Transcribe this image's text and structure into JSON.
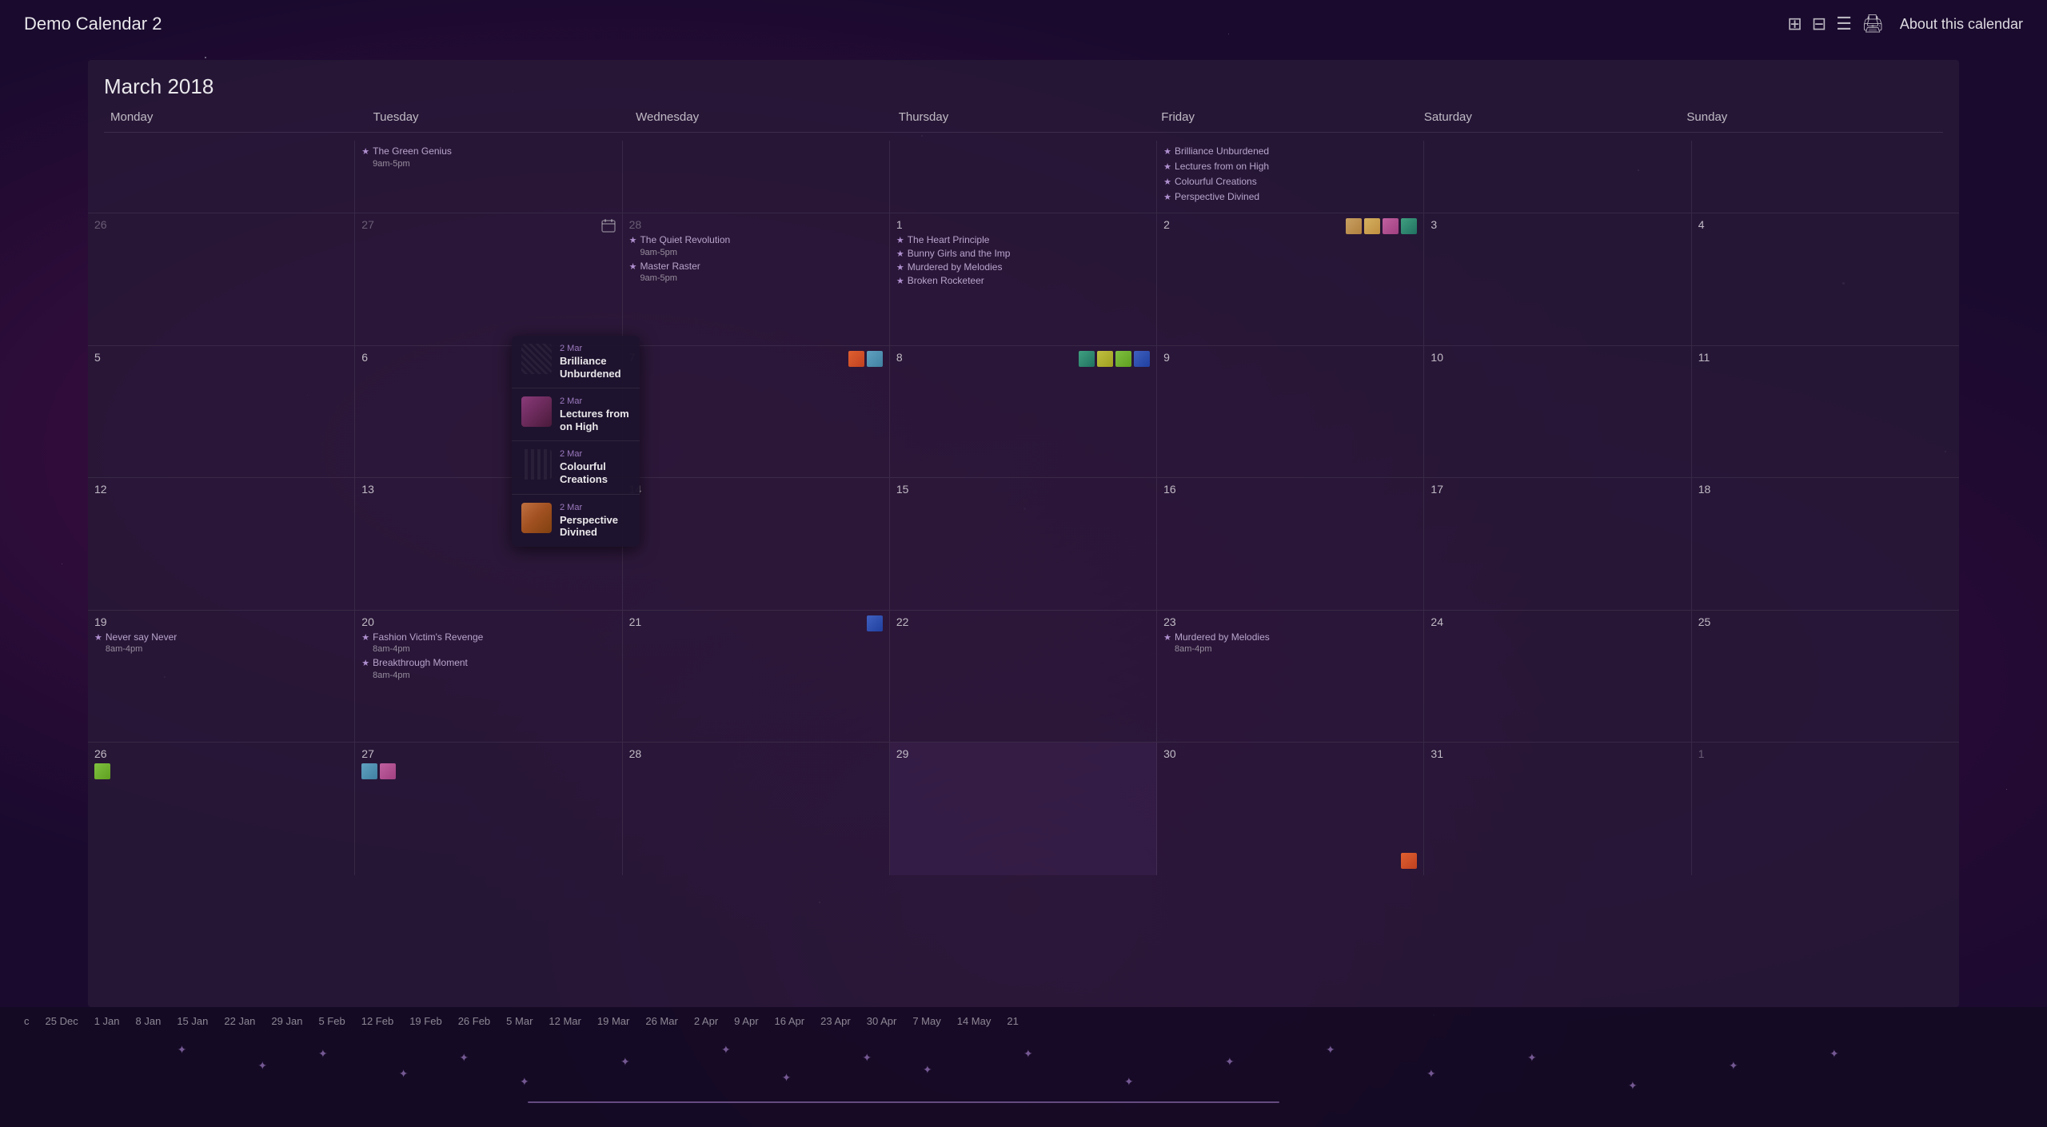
{
  "app": {
    "title": "Demo Calendar 2",
    "about_link": "About this calendar"
  },
  "calendar": {
    "month_title": "March 2018",
    "day_headers": [
      "Monday",
      "Tuesday",
      "Wednesday",
      "Thursday",
      "Friday",
      "Saturday",
      "Sunday"
    ],
    "prev_month_events": [
      {
        "date": "",
        "day_label": "Tuesday",
        "events": [
          {
            "name": "The Green Genius",
            "time": "9am-5pm"
          }
        ]
      },
      {
        "date": "",
        "day_label": "Friday",
        "events": [
          {
            "name": "Brilliance Unburdened"
          },
          {
            "name": "Lectures from on High"
          },
          {
            "name": "Colourful Creations"
          },
          {
            "name": "Perspective Divined"
          }
        ]
      }
    ],
    "weeks": [
      {
        "cells": [
          {
            "date": "26",
            "faded": true,
            "events": []
          },
          {
            "date": "27",
            "faded": true,
            "events": []
          },
          {
            "date": "28",
            "faded": true,
            "events": [
              {
                "name": "The Quiet Revolution",
                "time": "9am-5pm"
              },
              {
                "name": "Master Raster",
                "time": "9am-5pm"
              }
            ]
          },
          {
            "date": "1",
            "events": [
              {
                "name": "The Heart Principle"
              },
              {
                "name": "Bunny Girls and the Imp"
              },
              {
                "name": "Murdered by Melodies"
              },
              {
                "name": "Broken Rocketeer"
              }
            ]
          },
          {
            "date": "2",
            "events": [],
            "thumbs": [
              "tc1",
              "tc2",
              "tc3",
              "tc4"
            ]
          },
          {
            "date": "3",
            "events": []
          },
          {
            "date": "4",
            "events": []
          }
        ]
      },
      {
        "cells": [
          {
            "date": "5",
            "events": []
          },
          {
            "date": "6",
            "events": []
          },
          {
            "date": "7",
            "events": [],
            "thumbs": [
              "tc5",
              "tc6"
            ]
          },
          {
            "date": "8",
            "events": [],
            "thumbs": [
              "tc4",
              "tc9",
              "tc7",
              "tc8"
            ]
          },
          {
            "date": "9",
            "events": []
          },
          {
            "date": "10",
            "events": []
          },
          {
            "date": "11",
            "events": []
          }
        ]
      },
      {
        "cells": [
          {
            "date": "12",
            "events": []
          },
          {
            "date": "13",
            "events": []
          },
          {
            "date": "14",
            "events": []
          },
          {
            "date": "15",
            "events": []
          },
          {
            "date": "16",
            "events": []
          },
          {
            "date": "17",
            "events": []
          },
          {
            "date": "18",
            "events": []
          }
        ]
      },
      {
        "cells": [
          {
            "date": "19",
            "events": [
              {
                "name": "Never say Never",
                "time": "8am-4pm"
              }
            ]
          },
          {
            "date": "20",
            "events": [
              {
                "name": "Fashion Victim's Revenge",
                "time": "8am-4pm"
              },
              {
                "name": "Breakthrough Moment",
                "time": "8am-4pm"
              }
            ]
          },
          {
            "date": "21",
            "events": [],
            "thumbs_tr": [
              "tc8"
            ]
          },
          {
            "date": "22",
            "events": []
          },
          {
            "date": "23",
            "events": [
              {
                "name": "Murdered by Melodies",
                "time": "8am-4pm"
              }
            ]
          },
          {
            "date": "24",
            "events": []
          },
          {
            "date": "25",
            "events": []
          }
        ]
      },
      {
        "cells": [
          {
            "date": "26",
            "events": [],
            "thumbs": [
              "tc7"
            ]
          },
          {
            "date": "27",
            "events": [],
            "thumbs": [
              "tc6",
              "tc3"
            ]
          },
          {
            "date": "28",
            "events": []
          },
          {
            "date": "29",
            "active": true,
            "events": []
          },
          {
            "date": "30",
            "events": [],
            "thumbs_br": [
              "tc5"
            ]
          },
          {
            "date": "31",
            "events": []
          },
          {
            "date": "1",
            "faded": true,
            "events": []
          }
        ]
      }
    ]
  },
  "tooltip": {
    "items": [
      {
        "date_label": "2 Mar",
        "title": "Brilliance Unburdened",
        "img_class": "img-brilliance"
      },
      {
        "date_label": "2 Mar",
        "title": "Lectures from on High",
        "img_class": "img-lectures"
      },
      {
        "date_label": "2 Mar",
        "title": "Colourful Creations",
        "img_class": "img-colourful"
      },
      {
        "date_label": "2 Mar",
        "title": "Perspective Divined",
        "img_class": "img-perspective"
      }
    ]
  },
  "timeline": {
    "labels": [
      "c",
      "25 Dec",
      "1 Jan",
      "8 Jan",
      "15 Jan",
      "22 Jan",
      "29 Jan",
      "5 Feb",
      "12 Feb",
      "19 Feb",
      "26 Feb",
      "5 Mar",
      "12 Mar",
      "19 Mar",
      "26 Mar",
      "2 Apr",
      "9 Apr",
      "16 Apr",
      "23 Apr",
      "30 Apr",
      "7 May",
      "14 May",
      "21"
    ]
  }
}
